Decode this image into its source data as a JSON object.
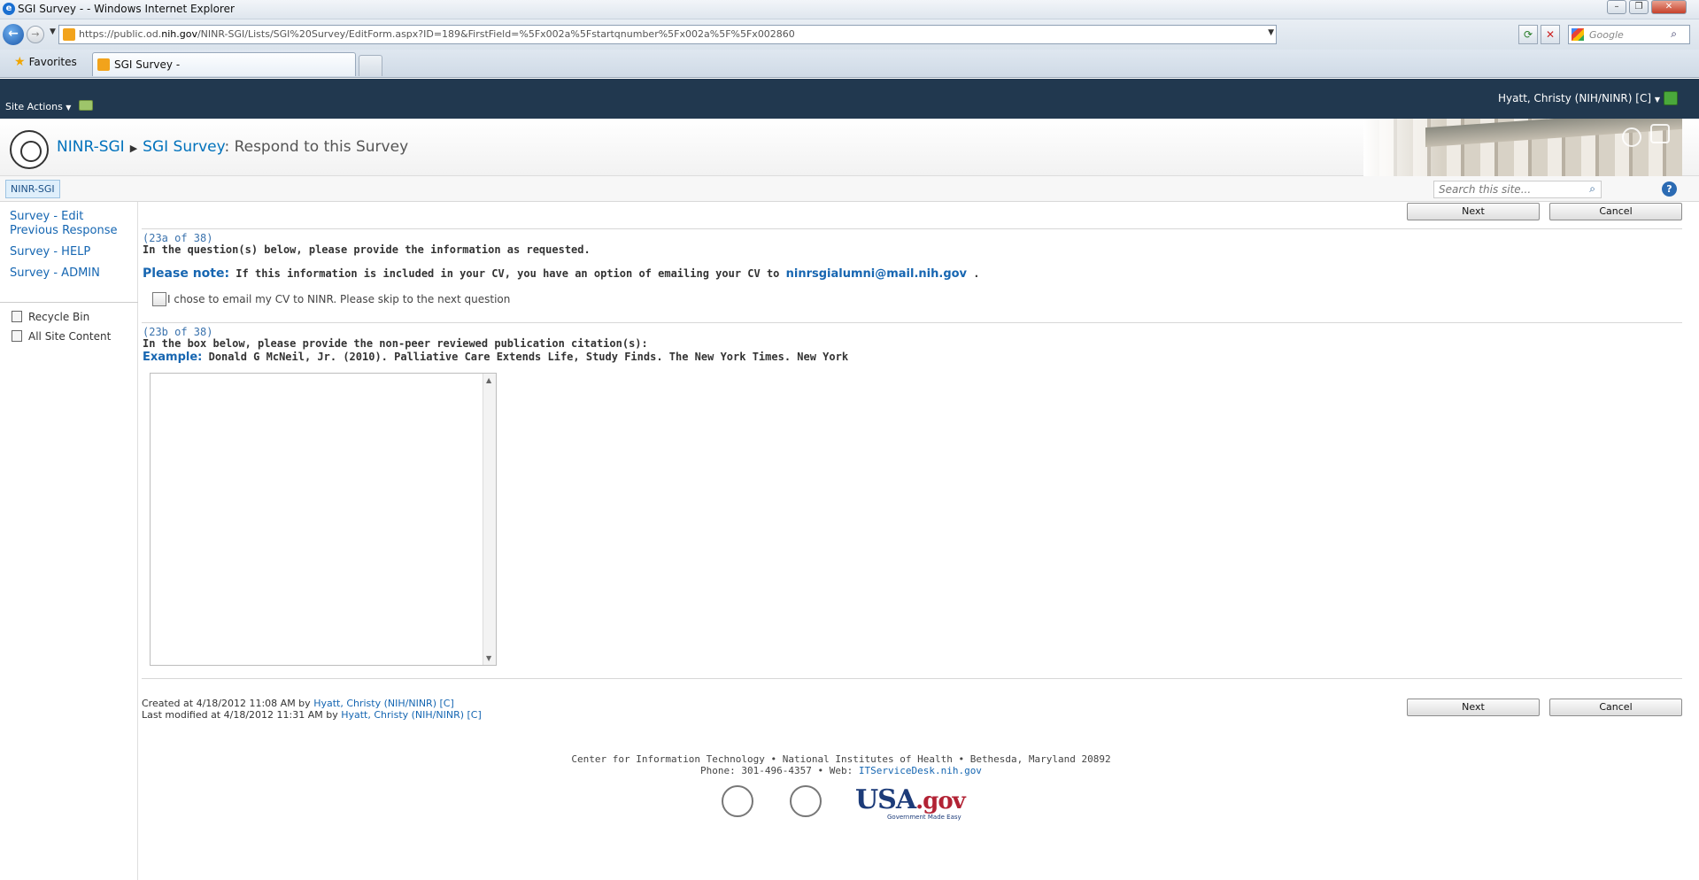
{
  "window": {
    "title": "SGI Survey - - Windows Internet Explorer"
  },
  "address": {
    "url_prefix": "https://public.od.",
    "url_domain": "nih.gov",
    "url_rest": "/NINR-SGI/Lists/SGI%20Survey/EditForm.aspx?ID=189&FirstField=%5Fx002a%5Fstartqnumber%5Fx002a%5F%5Fx002860",
    "search_placeholder": "Google"
  },
  "tabs": {
    "favorites_label": "Favorites",
    "active_tab_label": "SGI Survey -"
  },
  "ribbon": {
    "site_actions": "Site Actions",
    "user_name": "Hyatt, Christy (NIH/NINR) [C]"
  },
  "header": {
    "site": "NINR-SGI",
    "list": "SGI Survey",
    "page": ": Respond to this Survey"
  },
  "topnav": {
    "item": "NINR-SGI",
    "search_placeholder": "Search this site..."
  },
  "leftnav": {
    "links": [
      "Survey - Edit Previous Response",
      "Survey - HELP",
      "Survey - ADMIN"
    ],
    "recycle_bin": "Recycle Bin",
    "all_site_content": "All Site Content"
  },
  "buttons": {
    "next": "Next",
    "cancel": "Cancel"
  },
  "q23a": {
    "number": "(23a of 38)",
    "text": "In the question(s) below, please provide the information as requested.",
    "note_label": "Please note:",
    "note_text": " If this information is included in your CV, you have an option of emailing your CV to ",
    "email": "ninrsgialumni@mail.nih.gov",
    "note_end": " .",
    "checkbox_label": "I chose to email my CV to NINR. Please skip to the next question",
    "checkbox_checked": false
  },
  "q23b": {
    "number": "(23b of 38)",
    "text": "In the box below, please provide the non-peer reviewed publication citation(s):",
    "example_label": "Example:",
    "example_text": " Donald G McNeil, Jr. (2010). Palliative Care Extends Life, Study Finds. The New York Times. New York",
    "answer_value": ""
  },
  "meta": {
    "created_prefix": "Created at 4/18/2012 11:08 AM  by ",
    "created_by": "Hyatt, Christy (NIH/NINR) [C]",
    "modified_prefix": "Last modified at 4/18/2012 11:31 AM  by ",
    "modified_by": "Hyatt, Christy (NIH/NINR) [C]"
  },
  "footer": {
    "line1": "Center for Information Technology • National Institutes of Health • Bethesda, Maryland 20892",
    "line2_prefix": "Phone: 301-496-4357 • Web: ",
    "line2_link": "ITServiceDesk.nih.gov",
    "usa_main": "USA",
    "usa_gov": ".gov",
    "usa_sub": "Government Made Easy"
  }
}
